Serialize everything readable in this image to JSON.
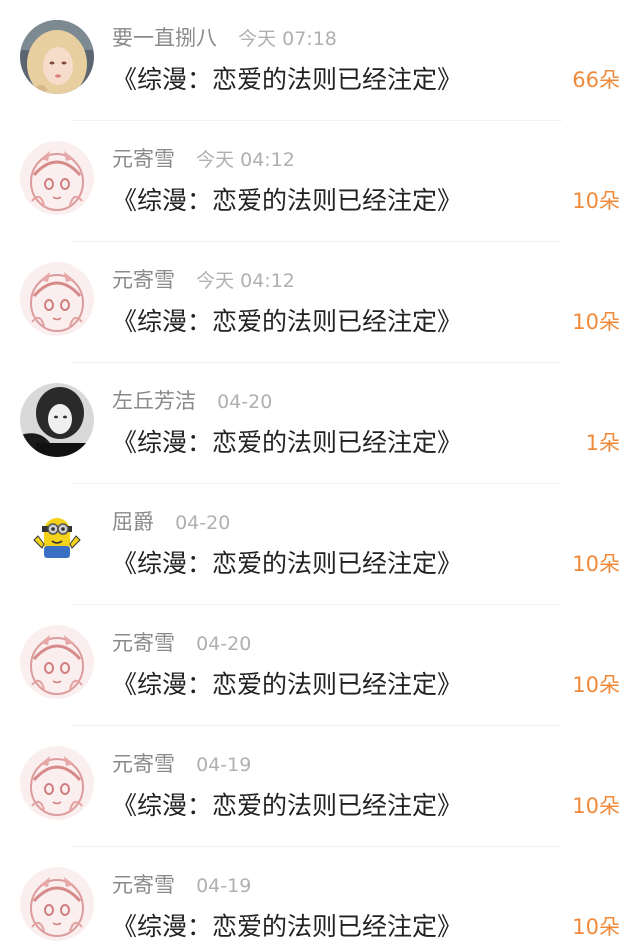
{
  "gifts": [
    {
      "user": "要一直捌八",
      "time": "今天 07:18",
      "title": "《综漫：恋爱的法则已经注定》",
      "count": "66朵",
      "avatar": "girl-photo-avatar"
    },
    {
      "user": "元寄雪",
      "time": "今天 04:12",
      "title": "《综漫：恋爱的法则已经注定》",
      "count": "10朵",
      "avatar": "anime-sketch-avatar"
    },
    {
      "user": "元寄雪",
      "time": "今天 04:12",
      "title": "《综漫：恋爱的法则已经注定》",
      "count": "10朵",
      "avatar": "anime-sketch-avatar"
    },
    {
      "user": "左丘芳洁",
      "time": "04-20",
      "title": "《综漫：恋爱的法则已经注定》",
      "count": "1朵",
      "avatar": "dark-photo-avatar"
    },
    {
      "user": "屈爵",
      "time": "04-20",
      "title": "《综漫：恋爱的法则已经注定》",
      "count": "10朵",
      "avatar": "minion-avatar"
    },
    {
      "user": "元寄雪",
      "time": "04-20",
      "title": "《综漫：恋爱的法则已经注定》",
      "count": "10朵",
      "avatar": "anime-sketch-avatar"
    },
    {
      "user": "元寄雪",
      "time": "04-19",
      "title": "《综漫：恋爱的法则已经注定》",
      "count": "10朵",
      "avatar": "anime-sketch-avatar"
    },
    {
      "user": "元寄雪",
      "time": "04-19",
      "title": "《综漫：恋爱的法则已经注定》",
      "count": "10朵",
      "avatar": "anime-sketch-avatar"
    }
  ],
  "colors": {
    "count": "#f08a3a",
    "username": "#8a8a8a",
    "time": "#b0b0b0",
    "title": "#222222"
  }
}
